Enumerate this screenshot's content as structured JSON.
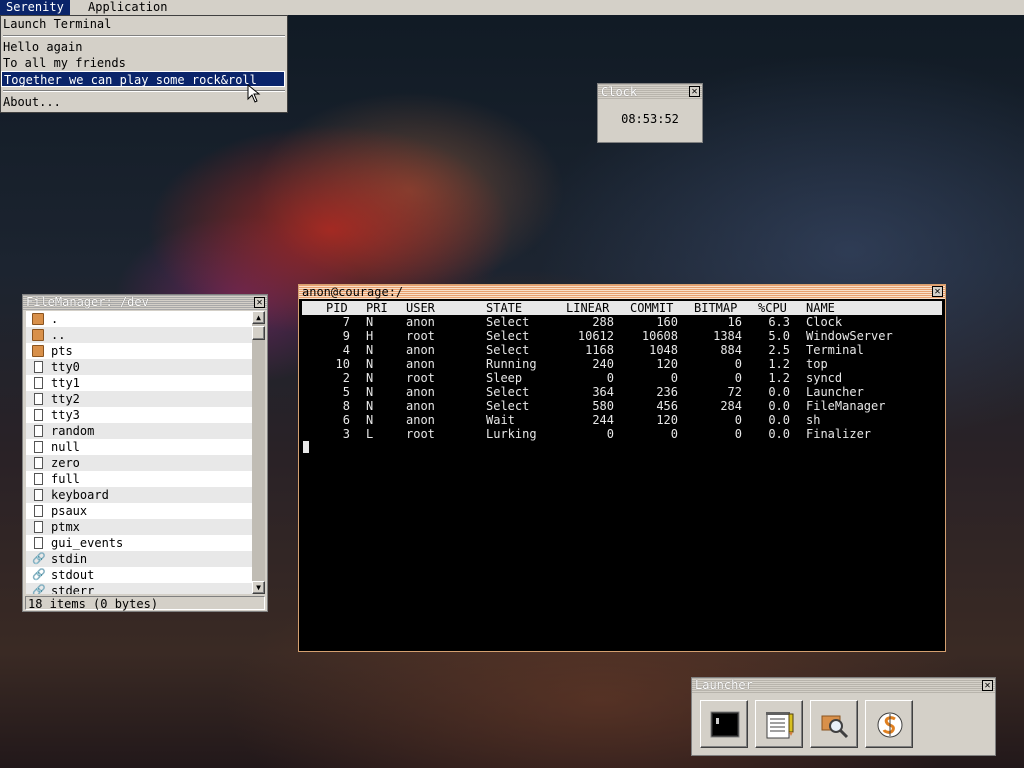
{
  "menubar": {
    "items": [
      {
        "label": "Serenity"
      },
      {
        "label": "Application"
      }
    ]
  },
  "menu": {
    "items": [
      {
        "label": "Launch Terminal"
      },
      {
        "label": "Hello again"
      },
      {
        "label": "To all my friends"
      },
      {
        "label": "Together we can play some rock&roll"
      },
      {
        "label": "About..."
      }
    ]
  },
  "clock": {
    "title": "Clock",
    "time": "08:53:52"
  },
  "terminal": {
    "title": "anon@courage:/",
    "columns": [
      "PID",
      "PRI",
      "USER",
      "STATE",
      "LINEAR",
      "COMMIT",
      "BITMAP",
      "%CPU",
      "NAME"
    ],
    "rows": [
      [
        "7",
        "N",
        "anon",
        "Select",
        "288",
        "160",
        "16",
        "6.3",
        "Clock"
      ],
      [
        "9",
        "H",
        "root",
        "Select",
        "10612",
        "10608",
        "1384",
        "5.0",
        "WindowServer"
      ],
      [
        "4",
        "N",
        "anon",
        "Select",
        "1168",
        "1048",
        "884",
        "2.5",
        "Terminal"
      ],
      [
        "10",
        "N",
        "anon",
        "Running",
        "240",
        "120",
        "0",
        "1.2",
        "top"
      ],
      [
        "2",
        "N",
        "root",
        "Sleep",
        "0",
        "0",
        "0",
        "1.2",
        "syncd"
      ],
      [
        "5",
        "N",
        "anon",
        "Select",
        "364",
        "236",
        "72",
        "0.0",
        "Launcher"
      ],
      [
        "8",
        "N",
        "anon",
        "Select",
        "580",
        "456",
        "284",
        "0.0",
        "FileManager"
      ],
      [
        "6",
        "N",
        "anon",
        "Wait",
        "244",
        "120",
        "0",
        "0.0",
        "sh"
      ],
      [
        "3",
        "L",
        "root",
        "Lurking",
        "0",
        "0",
        "0",
        "0.0",
        "Finalizer"
      ]
    ]
  },
  "filemanager": {
    "title": "FileManager: /dev",
    "items": [
      {
        "name": ".",
        "icon": "folder-icon"
      },
      {
        "name": "..",
        "icon": "folder-icon"
      },
      {
        "name": "pts",
        "icon": "folder-icon"
      },
      {
        "name": "tty0",
        "icon": "file-icon"
      },
      {
        "name": "tty1",
        "icon": "file-icon"
      },
      {
        "name": "tty2",
        "icon": "file-icon"
      },
      {
        "name": "tty3",
        "icon": "file-icon"
      },
      {
        "name": "random",
        "icon": "file-icon"
      },
      {
        "name": "null",
        "icon": "file-icon"
      },
      {
        "name": "zero",
        "icon": "file-icon"
      },
      {
        "name": "full",
        "icon": "file-icon"
      },
      {
        "name": "keyboard",
        "icon": "file-icon"
      },
      {
        "name": "psaux",
        "icon": "file-icon"
      },
      {
        "name": "ptmx",
        "icon": "file-icon"
      },
      {
        "name": "gui_events",
        "icon": "file-icon"
      },
      {
        "name": "stdin",
        "icon": "link-icon"
      },
      {
        "name": "stdout",
        "icon": "link-icon"
      },
      {
        "name": "stderr",
        "icon": "link-icon"
      }
    ],
    "status": "18 items (0 bytes)"
  },
  "launcher": {
    "title": "Launcher",
    "apps": [
      {
        "icon": "terminal-icon"
      },
      {
        "icon": "text-editor-icon"
      },
      {
        "icon": "file-search-icon"
      },
      {
        "icon": "serenity-app-icon"
      }
    ]
  }
}
